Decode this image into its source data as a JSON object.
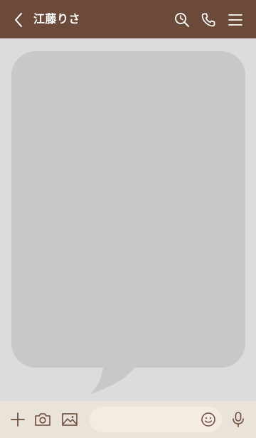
{
  "header": {
    "title": "江藤りさ",
    "background_color": "#6b4a3a",
    "icons": {
      "back": "chevron-left-icon",
      "search": "search-clock-icon",
      "call": "phone-icon",
      "menu": "hamburger-menu-icon"
    }
  },
  "chat": {
    "background_color": "#dcdcdc",
    "bubble_color": "#c8c8c8"
  },
  "input_bar": {
    "background_color": "#eae3da",
    "field_color": "#f4ece3",
    "message_value": "",
    "message_placeholder": "",
    "icons": {
      "plus": "plus-icon",
      "camera": "camera-icon",
      "gallery": "image-icon",
      "emoji": "smiley-icon",
      "mic": "microphone-icon"
    }
  }
}
